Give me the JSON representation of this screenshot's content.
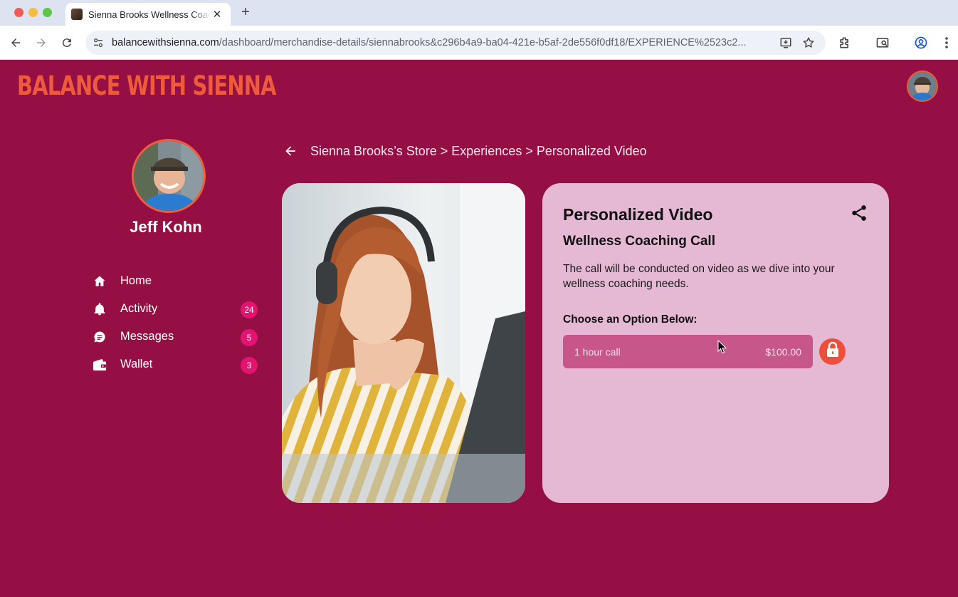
{
  "browser": {
    "tab_title": "Sienna Brooks Wellness Coac",
    "url_host": "balancewithsienna.com",
    "url_path": "/dashboard/merchandise-details/siennabrooks&c296b4a9-ba04-421e-b5af-2de556f0df18/EXPERIENCE%2523c2..."
  },
  "app": {
    "brand": "BALANCE WITH SIENNA",
    "colors": {
      "background": "#950f45",
      "accent": "#ee5a3a",
      "card": "#e5b9d3",
      "option": "#c7578a",
      "badge": "#e3136f"
    }
  },
  "profile": {
    "name": "Jeff Kohn"
  },
  "nav": {
    "items": [
      {
        "label": "Home",
        "icon": "home-icon",
        "badge": ""
      },
      {
        "label": "Activity",
        "icon": "bell-icon",
        "badge": "24"
      },
      {
        "label": "Messages",
        "icon": "message-icon",
        "badge": "5"
      },
      {
        "label": "Wallet",
        "icon": "wallet-icon",
        "badge": "3"
      }
    ]
  },
  "breadcrumb": {
    "text": "Sienna Brooks’s Store > Experiences > Personalized Video"
  },
  "product": {
    "title": "Personalized Video",
    "subtitle": "Wellness Coaching Call",
    "description": "The call will be conducted on video as we dive into your wellness coaching needs.",
    "choose_label": "Choose an Option Below:",
    "option": {
      "label": "1 hour call",
      "price": "$100.00"
    }
  }
}
